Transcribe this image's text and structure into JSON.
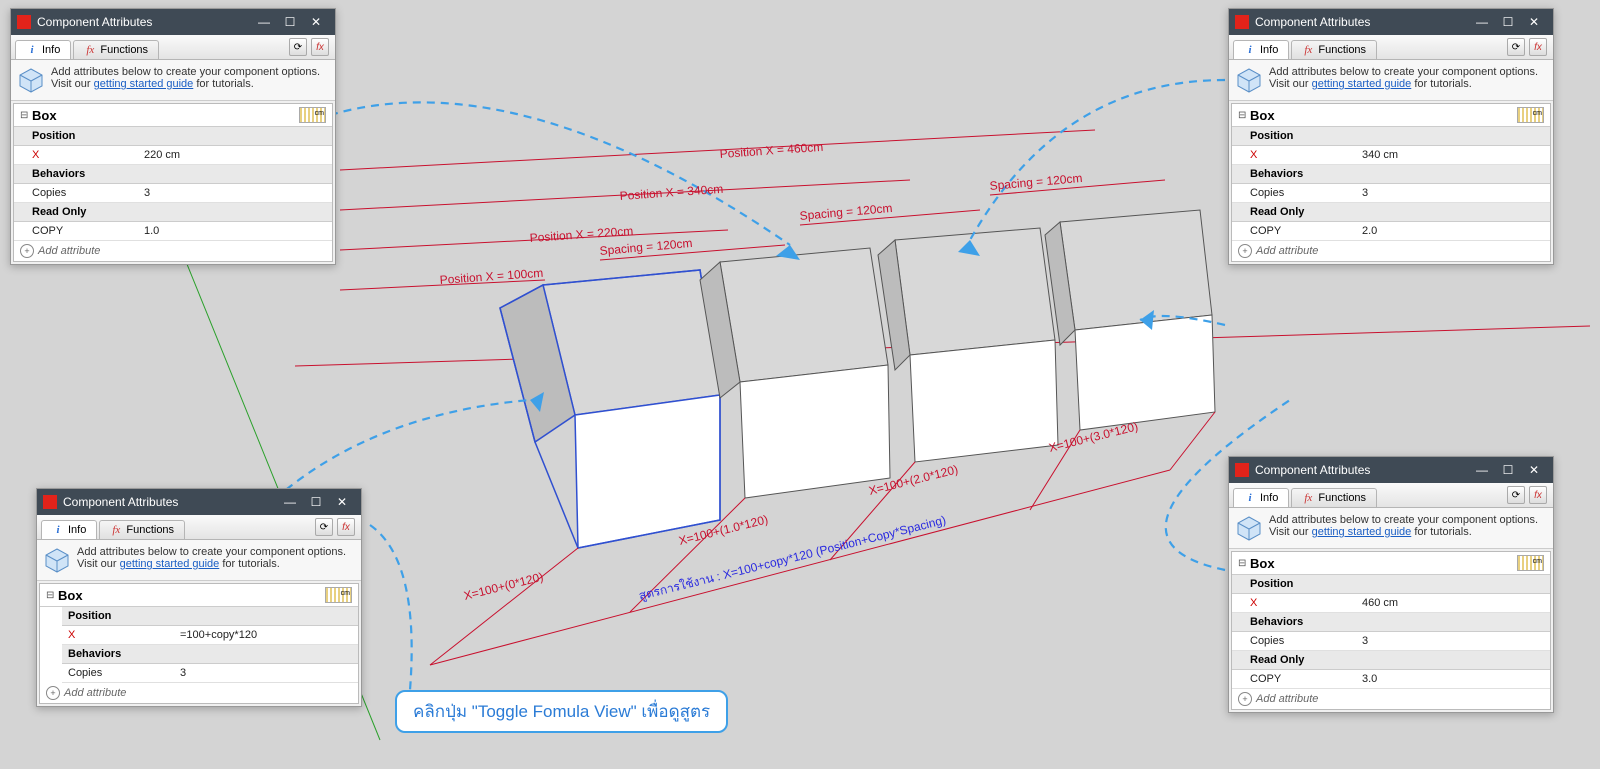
{
  "colors": {
    "accent": "#3ea0e8",
    "red": "#c8102e",
    "green": "#2aa02a",
    "blue": "#2a2ae0"
  },
  "panel_common": {
    "title": "Component Attributes",
    "tab_info": "Info",
    "tab_functions": "Functions",
    "hint_pre": "Add attributes below to create your component options. Visit our ",
    "hint_link": "getting started guide",
    "hint_post": " for tutorials.",
    "component_name": "Box",
    "unit_badge": "cm",
    "section_position": "Position",
    "section_behaviors": "Behaviors",
    "section_readonly": "Read Only",
    "attr_x": "X",
    "attr_copies": "Copies",
    "attr_copy": "COPY",
    "add_attribute": "Add attribute"
  },
  "panels": [
    {
      "id": "p1",
      "x_value": "220 cm",
      "copies": "3",
      "copy": "1.0",
      "has_readonly": true,
      "x_formula": null
    },
    {
      "id": "p2",
      "x_value": "340 cm",
      "copies": "3",
      "copy": "2.0",
      "has_readonly": true,
      "x_formula": null
    },
    {
      "id": "p3",
      "x_value": null,
      "copies": "3",
      "copy": null,
      "has_readonly": false,
      "x_formula": "=100+copy*120"
    },
    {
      "id": "p4",
      "x_value": "460 cm",
      "copies": "3",
      "copy": "3.0",
      "has_readonly": true,
      "x_formula": null
    }
  ],
  "scene": {
    "positions": [
      "Position X = 100cm",
      "Position X = 220cm",
      "Position X = 340cm",
      "Position X = 460cm"
    ],
    "spacings": [
      "Spacing = 120cm",
      "Spacing = 120cm",
      "Spacing = 120cm"
    ],
    "formulas": [
      "X=100+(0*120)",
      "X=100+(1.0*120)",
      "X=100+(2.0*120)",
      "X=100+(3.0*120)"
    ],
    "formula_note": "สูตรการใช้งาน : X=100+copy*120 (Position+Copy*Spacing)"
  },
  "callout": "คลิกปุ่ม \"Toggle Fomula View\" เพื่อดูสูตร"
}
